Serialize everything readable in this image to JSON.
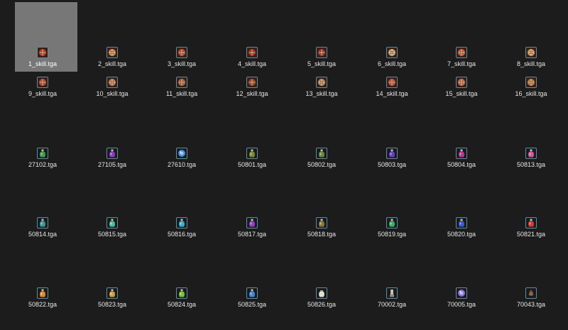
{
  "files": [
    {
      "name": "1_skill.tga",
      "icon": "skill-rune-icon",
      "kind": "skill",
      "color": "#d24a2c",
      "selected": true
    },
    {
      "name": "2_skill.tga",
      "icon": "skill-sun-icon",
      "kind": "skill",
      "color": "#e8a060"
    },
    {
      "name": "3_skill.tga",
      "icon": "skill-flower-icon",
      "kind": "skill",
      "color": "#d45a3a"
    },
    {
      "name": "4_skill.tga",
      "icon": "skill-slash-icon",
      "kind": "skill",
      "color": "#c43a2a"
    },
    {
      "name": "5_skill.tga",
      "icon": "skill-emblem-icon",
      "kind": "skill",
      "color": "#b84030"
    },
    {
      "name": "6_skill.tga",
      "icon": "skill-face-icon",
      "kind": "skill",
      "color": "#e0c080"
    },
    {
      "name": "7_skill.tga",
      "icon": "skill-star-icon",
      "kind": "skill",
      "color": "#e07050"
    },
    {
      "name": "8_skill.tga",
      "icon": "skill-flame-icon",
      "kind": "skill",
      "color": "#e8b070"
    },
    {
      "name": "9_skill.tga",
      "icon": "skill-sword-icon",
      "kind": "skill",
      "color": "#c85a3a"
    },
    {
      "name": "10_skill.tga",
      "icon": "skill-mask-icon",
      "kind": "skill",
      "color": "#d89060"
    },
    {
      "name": "11_skill.tga",
      "icon": "skill-gear-icon",
      "kind": "skill",
      "color": "#c8704a"
    },
    {
      "name": "12_skill.tga",
      "icon": "skill-orb-icon",
      "kind": "skill",
      "color": "#b8502a"
    },
    {
      "name": "13_skill.tga",
      "icon": "skill-spiral-icon",
      "kind": "skill",
      "color": "#d8a070"
    },
    {
      "name": "14_skill.tga",
      "icon": "skill-burst-icon",
      "kind": "skill",
      "color": "#e06040"
    },
    {
      "name": "15_skill.tga",
      "icon": "skill-boot-icon",
      "kind": "skill",
      "color": "#e07a60"
    },
    {
      "name": "16_skill.tga",
      "icon": "skill-pillar-icon",
      "kind": "skill",
      "color": "#d89050"
    },
    {
      "name": "27102.tga",
      "icon": "potion-green-icon",
      "kind": "potion",
      "color": "#3aa04a"
    },
    {
      "name": "27105.tga",
      "icon": "potion-purple-icon",
      "kind": "potion",
      "color": "#8a3ac0"
    },
    {
      "name": "27610.tga",
      "icon": "orb-blue-icon",
      "kind": "orb",
      "color": "#3a90e0"
    },
    {
      "name": "50801.tga",
      "icon": "potion-olive-icon",
      "kind": "potion",
      "color": "#7a8a2a"
    },
    {
      "name": "50802.tga",
      "icon": "potion-olive-icon",
      "kind": "potion",
      "color": "#6a8a3a"
    },
    {
      "name": "50803.tga",
      "icon": "potion-violet-icon",
      "kind": "potion",
      "color": "#6a3ad0"
    },
    {
      "name": "50804.tga",
      "icon": "potion-magenta-icon",
      "kind": "potion",
      "color": "#b03a90"
    },
    {
      "name": "50813.tga",
      "icon": "potion-pink-icon",
      "kind": "potion",
      "color": "#c85aa0"
    },
    {
      "name": "50814.tga",
      "icon": "potion-teal-icon",
      "kind": "potion",
      "color": "#3a9a9a"
    },
    {
      "name": "50815.tga",
      "icon": "potion-green-icon",
      "kind": "potion",
      "color": "#4ac0a0"
    },
    {
      "name": "50816.tga",
      "icon": "potion-cyan-icon",
      "kind": "potion",
      "color": "#3ab0d0"
    },
    {
      "name": "50817.tga",
      "icon": "potion-violet-icon",
      "kind": "potion",
      "color": "#9040c0"
    },
    {
      "name": "50818.tga",
      "icon": "potion-olive-icon",
      "kind": "potion",
      "color": "#8a7a3a"
    },
    {
      "name": "50819.tga",
      "icon": "potion-green-icon",
      "kind": "potion",
      "color": "#3ab06a"
    },
    {
      "name": "50820.tga",
      "icon": "potion-blue-icon",
      "kind": "potion",
      "color": "#3a5ad0"
    },
    {
      "name": "50821.tga",
      "icon": "potion-red-icon",
      "kind": "potion",
      "color": "#d03a3a"
    },
    {
      "name": "50822.tga",
      "icon": "potion-orange-icon",
      "kind": "potion",
      "color": "#e08a2a"
    },
    {
      "name": "50823.tga",
      "icon": "potion-gold-icon",
      "kind": "potion",
      "color": "#d0a03a"
    },
    {
      "name": "50824.tga",
      "icon": "potion-lime-icon",
      "kind": "potion",
      "color": "#7ac03a"
    },
    {
      "name": "50825.tga",
      "icon": "potion-skyblue-icon",
      "kind": "potion",
      "color": "#3a8ae0"
    },
    {
      "name": "50826.tga",
      "icon": "pouch-icon",
      "kind": "pouch",
      "color": "#e0e0d0"
    },
    {
      "name": "70002.tga",
      "icon": "gauntlet-icon",
      "kind": "gauntlet",
      "color": "#c0c0b0"
    },
    {
      "name": "70005.tga",
      "icon": "crystal-orb-icon",
      "kind": "orb",
      "color": "#8a6ae0"
    },
    {
      "name": "70043.tga",
      "icon": "herb-icon",
      "kind": "herb",
      "color": "#a07060"
    }
  ]
}
